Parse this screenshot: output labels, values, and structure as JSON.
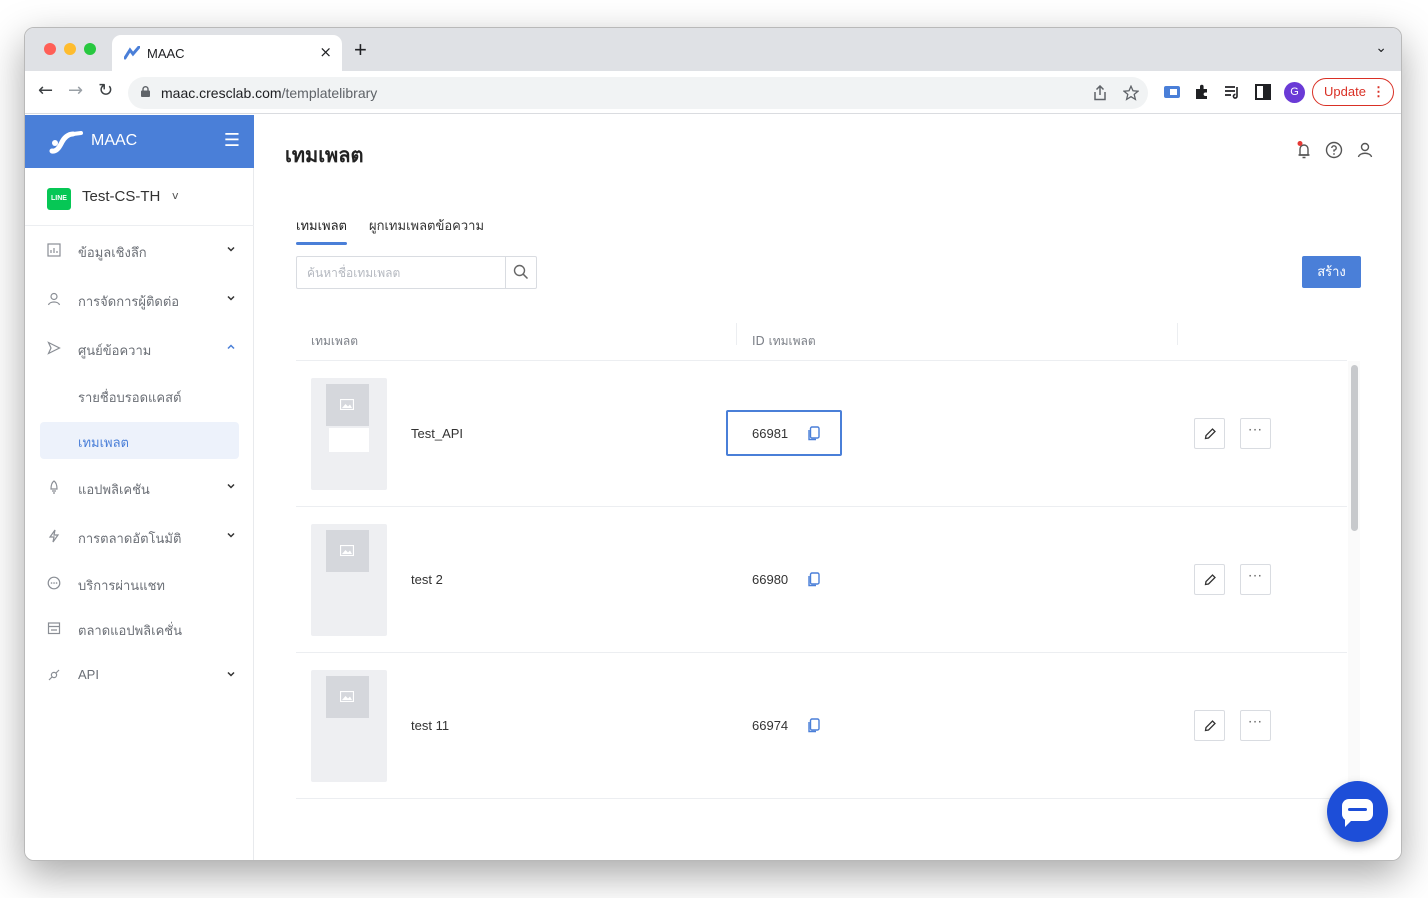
{
  "browser": {
    "tab_title": "MAAC",
    "tab_close": "×",
    "new_tab": "+",
    "tab_menu": "⌄",
    "url_domain": "maac.cresclab.com",
    "url_path": "/templatelibrary",
    "profile_initial": "G",
    "update_label": "Update",
    "update_menu": "⋮"
  },
  "sidebar": {
    "brand_name": "MAAC",
    "menu_icon": "☰",
    "account_badge": "LINE",
    "account_name": "Test-CS-TH",
    "account_caret": "v",
    "items": [
      {
        "label": "ข้อมูลเชิงลึก",
        "icon": "chart-icon",
        "expandable": true
      },
      {
        "label": "การจัดการผู้ติดต่อ",
        "icon": "user-icon",
        "expandable": true
      },
      {
        "label": "ศูนย์ข้อความ",
        "icon": "send-icon",
        "expandable": true,
        "expanded": true
      },
      {
        "label": "แอปพลิเคชัน",
        "icon": "app-icon",
        "expandable": true
      },
      {
        "label": "การตลาดอัตโนมัติ",
        "icon": "bolt-icon",
        "expandable": true
      },
      {
        "label": "บริการผ่านแชท",
        "icon": "chat-icon",
        "expandable": false
      },
      {
        "label": "ตลาดแอปพลิเคชั่น",
        "icon": "store-icon",
        "expandable": false
      },
      {
        "label": "API",
        "icon": "api-icon",
        "expandable": true
      }
    ],
    "subitems": [
      {
        "label": "รายชื่อบรอดแคสต์",
        "active": false
      },
      {
        "label": "เทมเพลต",
        "active": true
      }
    ]
  },
  "main": {
    "page_title": "เทมเพลต",
    "tabs": [
      {
        "label": "เทมเพลต",
        "active": true
      },
      {
        "label": "ผูกเทมเพลตข้อความ",
        "active": false
      }
    ],
    "search_placeholder": "ค้นหาชื่อเทมเพลต",
    "create_label": "สร้าง",
    "table": {
      "columns": [
        "เทมเพลต",
        "ID เทมเพลต"
      ],
      "rows": [
        {
          "name": "Test_API",
          "id": "66981",
          "highlighted": true
        },
        {
          "name": "test 2",
          "id": "66980",
          "highlighted": false
        },
        {
          "name": "test 11",
          "id": "66974",
          "highlighted": false
        }
      ],
      "more_label": "···"
    }
  },
  "colors": {
    "brand": "#4a7fd8",
    "chat_button": "#1d4ed8",
    "line_green": "#06c755",
    "update_red": "#d93025"
  }
}
